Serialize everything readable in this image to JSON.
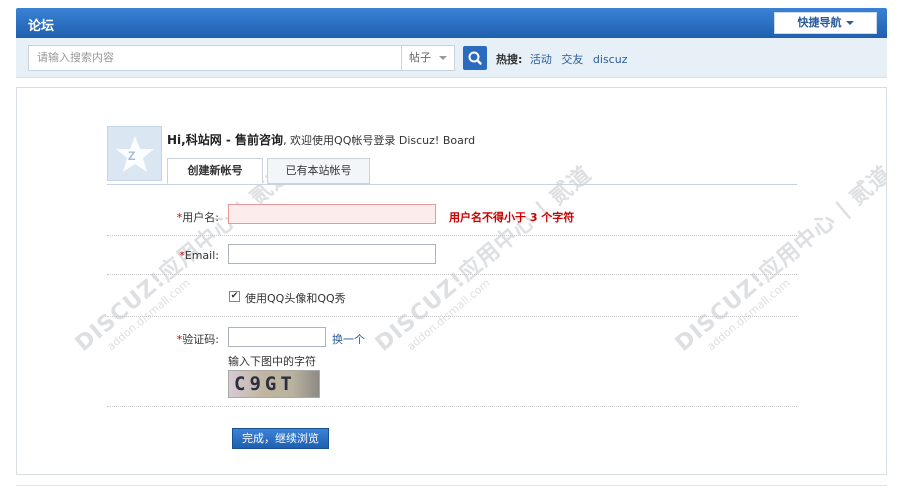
{
  "header": {
    "site_title": "论坛",
    "quicknav_label": "快捷导航"
  },
  "search": {
    "placeholder": "请输入搜索内容",
    "scope": "帖子",
    "hot_label": "热搜:",
    "hot_links": [
      "活动",
      "交友",
      "discuz"
    ]
  },
  "connect": {
    "greeting_prefix": "Hi,",
    "site_name": "科站网 - 售前咨询",
    "greeting_suffix": ", 欢迎使用QQ帐号登录 Discuz! Board",
    "tabs": [
      "创建新帐号",
      "已有本站帐号"
    ]
  },
  "form": {
    "username_label": "用户名:",
    "username_value": "",
    "username_error": "用户名不得小于 3 个字符",
    "email_label": "Email:",
    "email_value": "",
    "use_qq_avatar_label": "使用QQ头像和QQ秀",
    "use_qq_avatar_checked": true,
    "captcha_label": "验证码:",
    "captcha_value": "",
    "captcha_refresh": "换一个",
    "captcha_hint": "输入下图中的字符",
    "captcha_image_text": "C9GT",
    "submit_label": "完成，继续浏览"
  },
  "watermark": {
    "brand": "DISCUZ!应用中心 | 贰道",
    "domain": "addon.dismall.com"
  },
  "colors": {
    "topbar": "#2b6fc1",
    "link": "#2a5c9c",
    "error": "#cc0000"
  }
}
